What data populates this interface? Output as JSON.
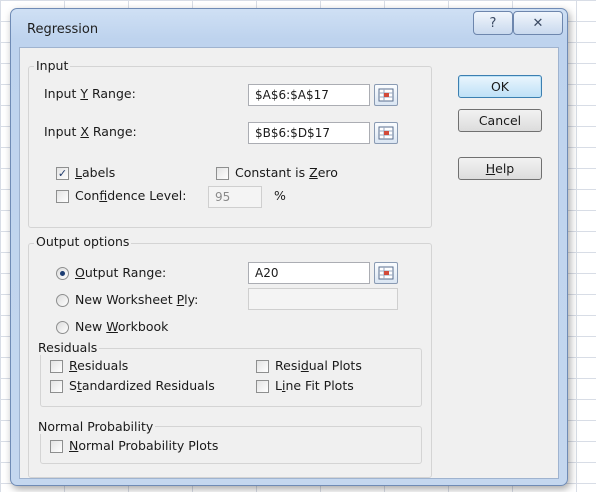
{
  "dialog": {
    "title": "Regression",
    "help_glyph": "?",
    "close_glyph": "✕"
  },
  "input_group": {
    "label": "Input",
    "y_range": {
      "label_pre": "Input ",
      "label_key": "Y",
      "label_post": " Range:",
      "value": "$A$6:$A$17"
    },
    "x_range": {
      "label_pre": "Input ",
      "label_key": "X",
      "label_post": " Range:",
      "value": "$B$6:$D$17"
    },
    "labels": {
      "label_key": "L",
      "label_post": "abels",
      "checked": true
    },
    "constant_zero": {
      "label_pre": "Constant is ",
      "label_key": "Z",
      "label_post": "ero",
      "checked": false
    },
    "confidence": {
      "label_pre": "Con",
      "label_key": "f",
      "label_post": "idence Level:",
      "checked": false,
      "value": "95",
      "unit": "%"
    }
  },
  "output_group": {
    "label": "Output options",
    "output_range": {
      "label_key": "O",
      "label_post": "utput Range:",
      "selected": true,
      "value": "A20"
    },
    "new_worksheet": {
      "label_pre": "New Worksheet ",
      "label_key": "P",
      "label_post": "ly:",
      "selected": false,
      "value": ""
    },
    "new_workbook": {
      "label_pre": "New ",
      "label_key": "W",
      "label_post": "orkbook",
      "selected": false
    }
  },
  "residuals_group": {
    "label": "Residuals",
    "residuals": {
      "label_key": "R",
      "label_post": "esiduals",
      "checked": false
    },
    "standardized": {
      "label_pre": "S",
      "label_key": "t",
      "label_post": "andardized Residuals",
      "checked": false
    },
    "residual_plots": {
      "label_pre": "Resi",
      "label_key": "d",
      "label_post": "ual Plots",
      "checked": false
    },
    "line_fit": {
      "label_pre": "L",
      "label_key": "i",
      "label_post": "ne Fit Plots",
      "checked": false
    }
  },
  "normal_group": {
    "label": "Normal Probability",
    "plots": {
      "label_key": "N",
      "label_post": "ormal Probability Plots",
      "checked": false
    }
  },
  "buttons": {
    "ok": "OK",
    "cancel": "Cancel",
    "help_key": "H",
    "help_post": "elp"
  },
  "check_glyph": "✓"
}
